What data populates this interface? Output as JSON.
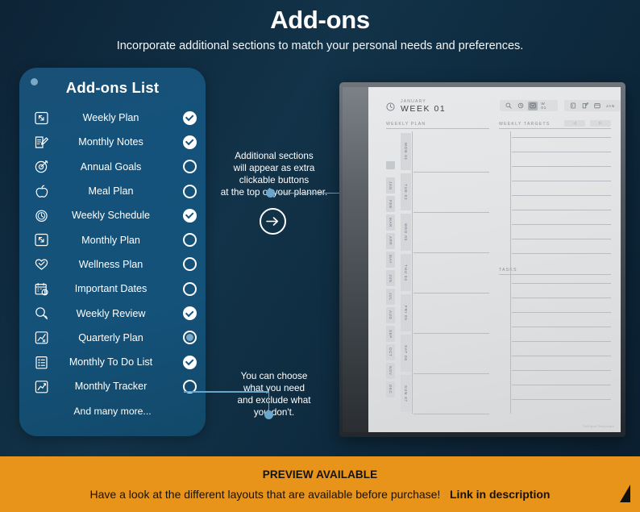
{
  "header": {
    "title": "Add-ons",
    "subtitle": "Incorporate additional sections to match your personal needs and preferences."
  },
  "addons_panel": {
    "title": "Add-ons List",
    "footer_note": "And many more...",
    "items": [
      {
        "label": "Weekly Plan",
        "icon": "plan-box-icon",
        "state": "checked"
      },
      {
        "label": "Monthly Notes",
        "icon": "note-pencil-icon",
        "state": "checked"
      },
      {
        "label": "Annual Goals",
        "icon": "target-icon",
        "state": "unchecked"
      },
      {
        "label": "Meal Plan",
        "icon": "apple-icon",
        "state": "unchecked"
      },
      {
        "label": "Weekly  Schedule",
        "icon": "clock-icon",
        "state": "checked"
      },
      {
        "label": "Monthly Plan",
        "icon": "plan-box-icon",
        "state": "unchecked"
      },
      {
        "label": "Wellness Plan",
        "icon": "heart-check-icon",
        "state": "unchecked"
      },
      {
        "label": "Important Dates",
        "icon": "calendar-alert-icon",
        "state": "unchecked"
      },
      {
        "label": "Weekly Review",
        "icon": "magnifier-icon",
        "state": "checked"
      },
      {
        "label": "Quarterly Plan",
        "icon": "chart-x-icon",
        "state": "marked"
      },
      {
        "label": "Monthly To Do List",
        "icon": "list-icon",
        "state": "checked"
      },
      {
        "label": "Monthly Tracker",
        "icon": "trend-chart-icon",
        "state": "unchecked"
      }
    ]
  },
  "callouts": {
    "top": "Additional sections\nwill appear as extra\nclickable buttons\nat the top of your planner.",
    "top_lines": [
      "Additional sections",
      "will appear as extra",
      "clickable buttons",
      "at the top of your planner."
    ],
    "bottom_lines": [
      "You can choose",
      "what you need",
      "and exclude what",
      "you don't."
    ],
    "arrow_glyph": "→"
  },
  "planner": {
    "month_label": "JANUARY",
    "week_label": "WEEK 01",
    "toolbar": {
      "search_icon": "search-icon",
      "clock_icon": "clock-icon",
      "addon_icon": "addons-icon",
      "week_label": "W 01",
      "note_icon": "note-icon",
      "edit_icon": "edit-icon",
      "calendar_icon": "calendar-icon",
      "month_label": "JAN"
    },
    "sections": {
      "weekly_plan": "WEEKLY PLAN",
      "weekly_targets": "WEEKLY TARGETS",
      "tasks": "TASKS"
    },
    "nav": {
      "prev": "◁",
      "next": "▷"
    },
    "days": [
      "MON 01",
      "TUE 02",
      "WED 03",
      "THU 04",
      "FRI 05",
      "SAT 06",
      "SUN 07"
    ],
    "months": [
      "JAN",
      "FEB",
      "MAR",
      "APR",
      "MAY",
      "JUN",
      "JUL",
      "AUG",
      "SEP",
      "OCT",
      "NOV",
      "DEC"
    ],
    "watermark": "©ePaperTemplates"
  },
  "bottom_bar": {
    "title": "PREVIEW AVAILABLE",
    "subtitle": "Have a look at the different layouts that are available before purchase!",
    "link_text": "Link in description"
  },
  "colors": {
    "background_dark": "#0d2336",
    "panel_blue": "#14527a",
    "accent_blue": "#6aa5cc",
    "bar_orange": "#e8941a",
    "white": "#ffffff"
  }
}
